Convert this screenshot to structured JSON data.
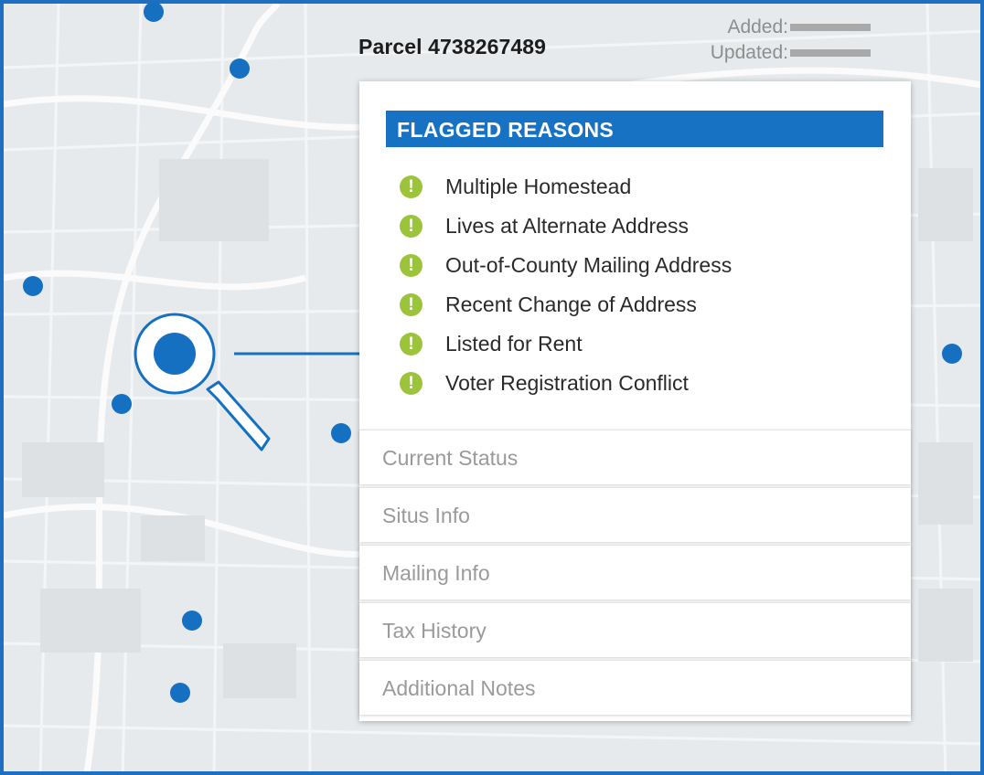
{
  "parcel": {
    "title": "Parcel 4738267489"
  },
  "meta": {
    "added_label": "Added:",
    "updated_label": "Updated:"
  },
  "flagged": {
    "header": "FLAGGED REASONS",
    "reasons": [
      "Multiple Homestead",
      "Lives at Alternate Address",
      "Out-of-County Mailing Address",
      "Recent Change of Address",
      "Listed for Rent",
      "Voter Registration Conflict"
    ]
  },
  "sections": [
    "Current Status",
    "Situs Info",
    "Mailing Info",
    "Tax History",
    "Additional Notes"
  ],
  "icons": {
    "reason": "exclamation-icon",
    "search": "magnifier-icon",
    "marker": "map-dot"
  },
  "colors": {
    "accent": "#1772c4",
    "warning": "#9cc43a",
    "frame": "#1f6fc0",
    "map_bg": "#e7eaec"
  }
}
